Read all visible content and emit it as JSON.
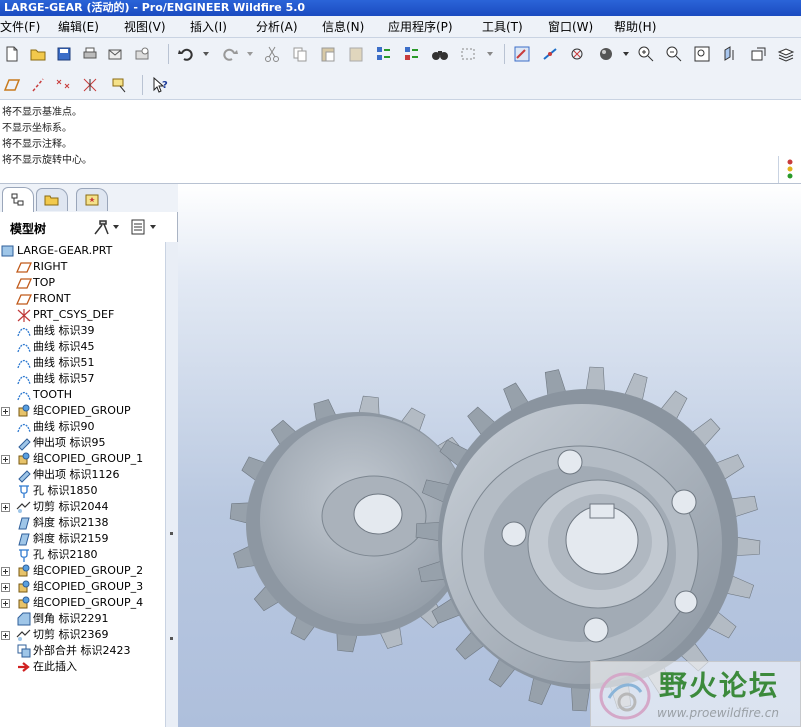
{
  "window": {
    "title": "LARGE-GEAR (活动的) - Pro/ENGINEER Wildfire 5.0"
  },
  "menu": [
    {
      "label": "文件(F)"
    },
    {
      "label": "编辑(E)"
    },
    {
      "label": "视图(V)"
    },
    {
      "label": "插入(I)"
    },
    {
      "label": "分析(A)"
    },
    {
      "label": "信息(N)"
    },
    {
      "label": "应用程序(P)"
    },
    {
      "label": "工具(T)"
    },
    {
      "label": "窗口(W)"
    },
    {
      "label": "帮助(H)"
    }
  ],
  "messages": [
    "将不显示基准点。",
    "不显示坐标系。",
    "将不显示注释。",
    "将不显示旋转中心。"
  ],
  "model_tree": {
    "header": "模型树",
    "items": [
      {
        "label": "LARGE-GEAR.PRT",
        "icon": "part-icon"
      },
      {
        "label": "RIGHT",
        "icon": "datum-plane-icon"
      },
      {
        "label": "TOP",
        "icon": "datum-plane-icon"
      },
      {
        "label": "FRONT",
        "icon": "datum-plane-icon"
      },
      {
        "label": "PRT_CSYS_DEF",
        "icon": "csys-icon"
      },
      {
        "label": "曲线 标识39",
        "icon": "curve-icon"
      },
      {
        "label": "曲线 标识45",
        "icon": "curve-icon"
      },
      {
        "label": "曲线 标识51",
        "icon": "curve-icon"
      },
      {
        "label": "曲线 标识57",
        "icon": "curve-icon"
      },
      {
        "label": "TOOTH",
        "icon": "curve-icon"
      },
      {
        "label": "组COPIED_GROUP",
        "icon": "group-icon"
      },
      {
        "label": "曲线 标识90",
        "icon": "curve-icon"
      },
      {
        "label": "伸出项 标识95",
        "icon": "extrude-icon"
      },
      {
        "label": "组COPIED_GROUP_1",
        "icon": "group-icon"
      },
      {
        "label": "伸出项 标识1126",
        "icon": "extrude-icon"
      },
      {
        "label": "孔 标识1850",
        "icon": "hole-icon"
      },
      {
        "label": "切剪 标识2044",
        "icon": "cut-icon"
      },
      {
        "label": "斜度 标识2138",
        "icon": "draft-icon"
      },
      {
        "label": "斜度 标识2159",
        "icon": "draft-icon"
      },
      {
        "label": "孔 标识2180",
        "icon": "hole-icon"
      },
      {
        "label": "组COPIED_GROUP_2",
        "icon": "group-icon"
      },
      {
        "label": "组COPIED_GROUP_3",
        "icon": "group-icon"
      },
      {
        "label": "组COPIED_GROUP_4",
        "icon": "group-icon"
      },
      {
        "label": "倒角 标识2291",
        "icon": "chamfer-icon"
      },
      {
        "label": "切剪 标识2369",
        "icon": "cut-icon"
      },
      {
        "label": "外部合并 标识2423",
        "icon": "merge-icon"
      },
      {
        "label": "在此插入",
        "icon": "insert-here-icon"
      }
    ]
  },
  "watermark": {
    "title": "野火论坛",
    "url": "www.proewildfire.cn"
  },
  "colors": {
    "titlebar": "#1b4bc0",
    "viewport_bg": "#b9c8e0",
    "gear": "#a6b0ba"
  }
}
